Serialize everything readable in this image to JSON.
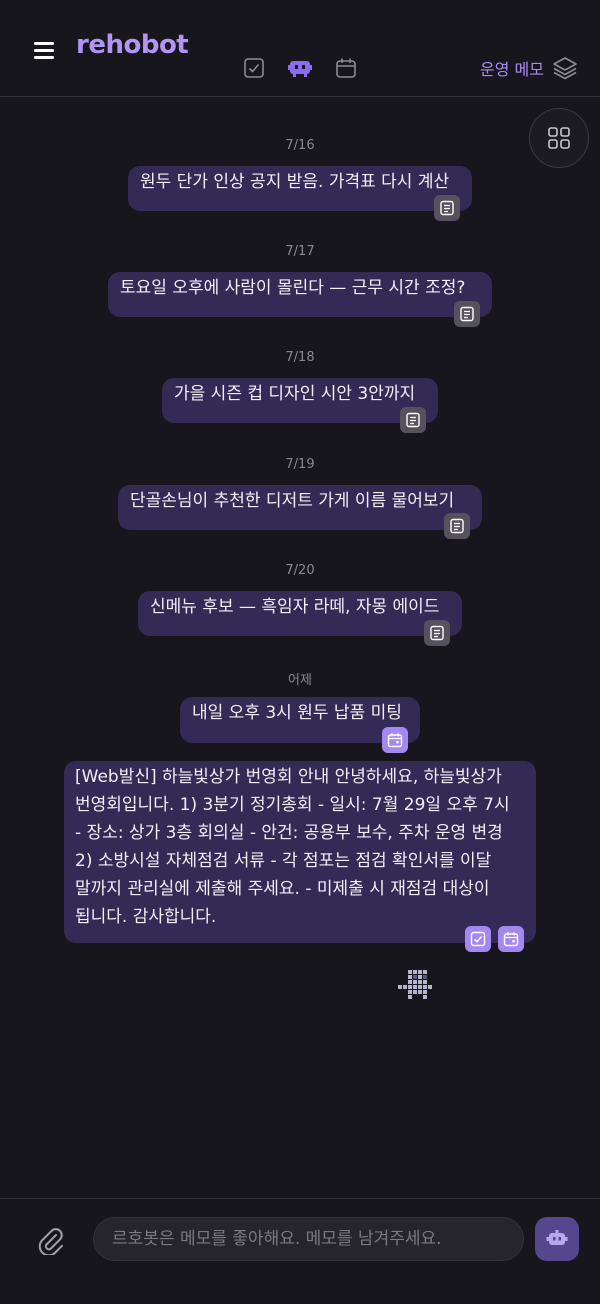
{
  "header": {
    "title": "rehobot",
    "ops_memo_label": "운영 메모"
  },
  "icons": {
    "menu": "menu-icon",
    "tabs": [
      "checkbox-icon",
      "robot-icon",
      "calendar-icon"
    ],
    "ops_memo": "layers-icon",
    "grid": "grid-icon",
    "attach": "paperclip-icon",
    "send": "robot-icon",
    "note_tag": "note-icon"
  },
  "colors": {
    "background": "#18161d",
    "accent": "#b195f5",
    "bubble": "#332b55",
    "tag_purple": "#a488ef"
  },
  "feed": [
    {
      "date": "7/16",
      "text": "원두 단가 인상 공지 받음. 가격표 다시 계산",
      "tags": [
        "note"
      ]
    },
    {
      "date": "7/17",
      "text": "토요일 오후에 사람이 몰린다 — 근무 시간 조정?",
      "tags": [
        "note"
      ]
    },
    {
      "date": "7/18",
      "text": "가을 시즌 컵 디자인 시안 3안까지",
      "tags": [
        "note"
      ]
    },
    {
      "date": "7/19",
      "text": "단골손님이 추천한 디저트 가게 이름 물어보기",
      "tags": [
        "note"
      ]
    },
    {
      "date": "7/20",
      "text": "신메뉴 후보 — 흑임자 라떼, 자몽 에이드",
      "tags": [
        "note"
      ]
    },
    {
      "date": "어제",
      "text": "내일 오후 3시 원두 납품 미팅",
      "tags": [
        "calendar"
      ]
    },
    {
      "date": "",
      "lines": [
        "[Web발신] 하늘빛상가 번영회 안내 안녕하세요, 하늘빛상가",
        "번영회입니다. 1) 3분기 정기총회 - 일시: 7월 29일 오후 7시",
        "- 장소: 상가 3층 회의실 - 안건: 공용부 보수, 주차 운영 변경",
        "2) 소방시설 자체점검 서류 - 각 점포는 점검 확인서를 이달",
        "말까지 관리실에 제출해 주세요. - 미제출 시 재점검 대상이",
        "됩니다. 감사합니다."
      ],
      "tags": [
        "todo",
        "calendar"
      ]
    }
  ],
  "composer": {
    "placeholder": "르호봇은 메모를 좋아해요. 메모를 남겨주세요."
  }
}
